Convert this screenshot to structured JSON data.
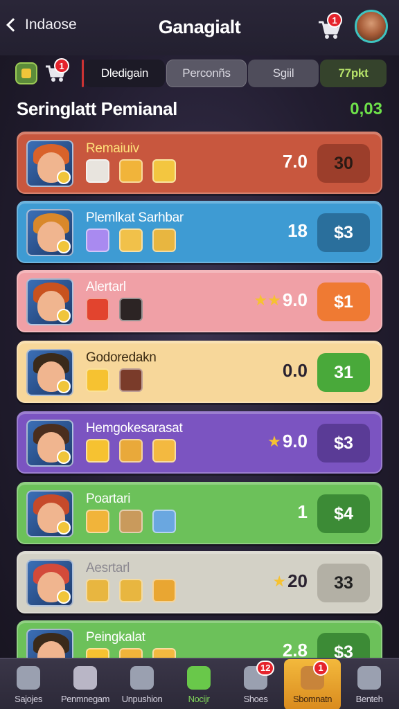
{
  "header": {
    "back_label": "Indaose",
    "title": "Ganagialt",
    "cart_badge": "1"
  },
  "tabs": {
    "left_badge": "1",
    "items": [
      {
        "label": "Dledigain",
        "active": true
      },
      {
        "label": "Perconñs",
        "active": false
      },
      {
        "label": "Sgiil",
        "active": false
      },
      {
        "label": "77pkt",
        "active": false
      }
    ]
  },
  "section": {
    "title": "Seringlatt Pemianal",
    "value": "0,03"
  },
  "cards": [
    {
      "name": "Remaiuiv",
      "score": "7.0",
      "stars": "",
      "price": "30",
      "bg": "#c8573e",
      "price_bg": "#9c3e2b",
      "name_color": "#ffe17a",
      "icons": [
        "flag-icon",
        "gem-icon",
        "crown-icon"
      ]
    },
    {
      "name": "Plemlkat Sarhbar",
      "score": "18",
      "stars": "",
      "price": "$3",
      "bg": "#3e9bd3",
      "price_bg": "#2a6f9c",
      "name_color": "#ffffff",
      "icons": [
        "crystal-icon",
        "gear-icon",
        "shield-icon"
      ]
    },
    {
      "name": "Alertarl",
      "score": "9.0",
      "stars": "★★",
      "price": "$1",
      "bg": "#f0a0a6",
      "price_bg": "#ef7a33",
      "name_color": "#ffffff",
      "icons": [
        "ruby-icon",
        "sword-icon"
      ]
    },
    {
      "name": "Godoredakn",
      "score": "0.0",
      "stars": "",
      "price": "31",
      "bg": "#f7d79a",
      "price_bg": "#49a93a",
      "name_color": "#3a2a12",
      "icons": [
        "star-icon",
        "scroll-icon"
      ]
    },
    {
      "name": "Hemgokesarasat",
      "score": "9.0",
      "stars": "★",
      "price": "$3",
      "bg": "#7b54c1",
      "price_bg": "#5a3b96",
      "name_color": "#ffffff",
      "icons": [
        "star-icon",
        "ring-icon",
        "chest-icon"
      ]
    },
    {
      "name": "Poartari",
      "score": "1",
      "stars": "",
      "price": "$4",
      "bg": "#6cc15a",
      "price_bg": "#3c8b36",
      "name_color": "#ffffff",
      "icons": [
        "gem-icon",
        "box-icon",
        "book-icon"
      ]
    },
    {
      "name": "Aesrtarl",
      "score": "20",
      "stars": "★",
      "price": "33",
      "bg": "#d3d1c6",
      "price_bg": "#b3b0a5",
      "name_color": "#8b8890",
      "icons": [
        "shield-icon",
        "coin-icon",
        "cross-icon"
      ]
    },
    {
      "name": "Peingkalat",
      "score": "2.8",
      "stars": "",
      "price": "$3",
      "bg": "#6cc15a",
      "price_bg": "#3c8b36",
      "name_color": "#ffffff",
      "icons": [
        "star-icon",
        "gem-icon",
        "chest-icon"
      ]
    }
  ],
  "nav": [
    {
      "label": "Sajojes",
      "icon": "home-icon",
      "badge": "",
      "active": false
    },
    {
      "label": "Penmnegam",
      "icon": "grid-icon",
      "badge": "",
      "active": false
    },
    {
      "label": "Unpushion",
      "icon": "heart-icon",
      "badge": "",
      "active": false
    },
    {
      "label": "Nocijr",
      "icon": "gamepad-icon",
      "badge": "",
      "active": false
    },
    {
      "label": "Shoes",
      "icon": "cart-icon",
      "badge": "12",
      "active": false
    },
    {
      "label": "Sbomnatn",
      "icon": "avatar-icon",
      "badge": "1",
      "active": true
    },
    {
      "label": "Benteh",
      "icon": "profile-icon",
      "badge": "",
      "active": false
    }
  ]
}
